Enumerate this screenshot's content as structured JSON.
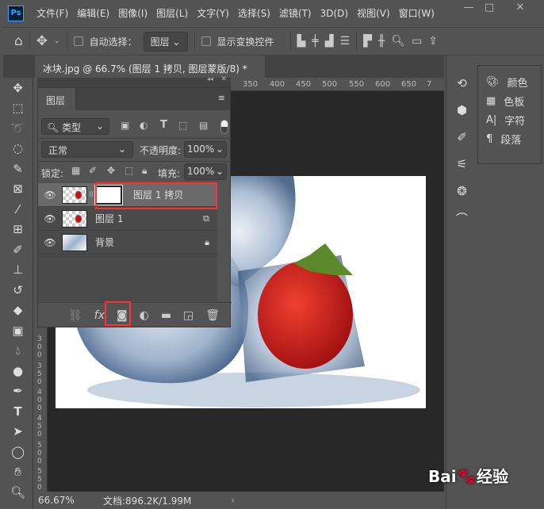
{
  "menu": {
    "items": [
      "文件(F)",
      "编辑(E)",
      "图像(I)",
      "图层(L)",
      "文字(Y)",
      "选择(S)",
      "滤镜(T)",
      "3D(D)",
      "视图(V)",
      "窗口(W)"
    ],
    "logo": "Ps"
  },
  "options": {
    "auto_select_label": "自动选择：",
    "auto_select_value": "图层",
    "show_transform_label": "显示变换控件"
  },
  "document": {
    "tab_title": "冰块.jpg @ 66.7% (图层 1 拷贝, 图层蒙版/8) *",
    "close": "×"
  },
  "ruler": {
    "top": [
      "350",
      "400",
      "450",
      "500",
      "550",
      "600",
      "650",
      "7"
    ],
    "left": [
      "300",
      "350",
      "400",
      "450",
      "500",
      "550"
    ]
  },
  "layers_panel": {
    "title": "图层",
    "filter_value": "类型",
    "blend_mode": "正常",
    "opacity_label": "不透明度:",
    "opacity_value": "100%",
    "lock_label": "锁定:",
    "fill_label": "填充:",
    "fill_value": "100%",
    "layers": [
      {
        "name": "图层 1 拷贝",
        "selected": true,
        "has_mask": true
      },
      {
        "name": "图层 1",
        "selected": false
      },
      {
        "name": "背景",
        "selected": false,
        "locked": true
      }
    ]
  },
  "right_panel": {
    "items": [
      {
        "label": "颜色",
        "icon": "palette-icon"
      },
      {
        "label": "色板",
        "icon": "swatches-icon"
      },
      {
        "label": "字符",
        "icon": "character-icon"
      },
      {
        "label": "段落",
        "icon": "paragraph-icon"
      }
    ]
  },
  "status": {
    "zoom": "66.67%",
    "doc_info": "文档:896.2K/1.99M"
  },
  "watermark": "Baidu经验 jingyan.baidu.com",
  "colors": {
    "highlight": "#ff3030",
    "ps_blue": "#31a8ff"
  }
}
